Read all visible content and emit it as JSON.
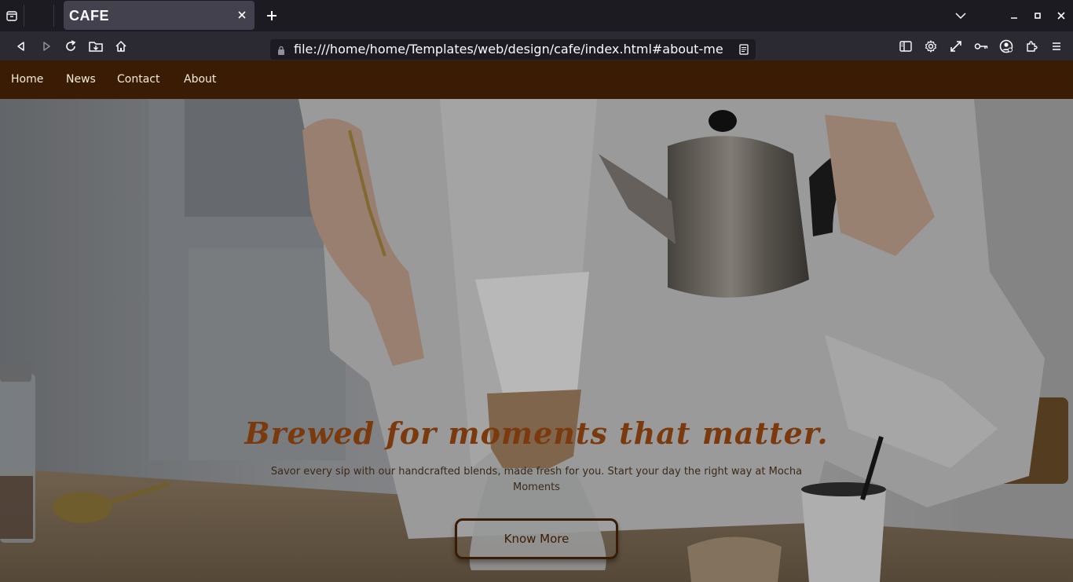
{
  "browser": {
    "tab_title": "CAFE",
    "url": "file:///home/home/Templates/web/design/cafe/index.html#about-me"
  },
  "site_nav": {
    "items": [
      {
        "label": "Home"
      },
      {
        "label": "News"
      },
      {
        "label": "Contact"
      },
      {
        "label": "About"
      }
    ]
  },
  "hero": {
    "title": "Brewed for moments that matter.",
    "subtitle": "Savor every sip with our handcrafted blends, made fresh for you. Start your day the right way at Mocha Moments",
    "button_label": "Know More"
  },
  "colors": {
    "nav_bg": "#3a1c04",
    "title": "#7a3a0e",
    "browser_bg": "#1c1b22"
  },
  "icons": {
    "tab_list": "tab-list-icon",
    "new_tab": "plus-icon",
    "back": "back-icon",
    "forward": "forward-icon",
    "reload": "reload-icon",
    "home": "home-icon"
  }
}
